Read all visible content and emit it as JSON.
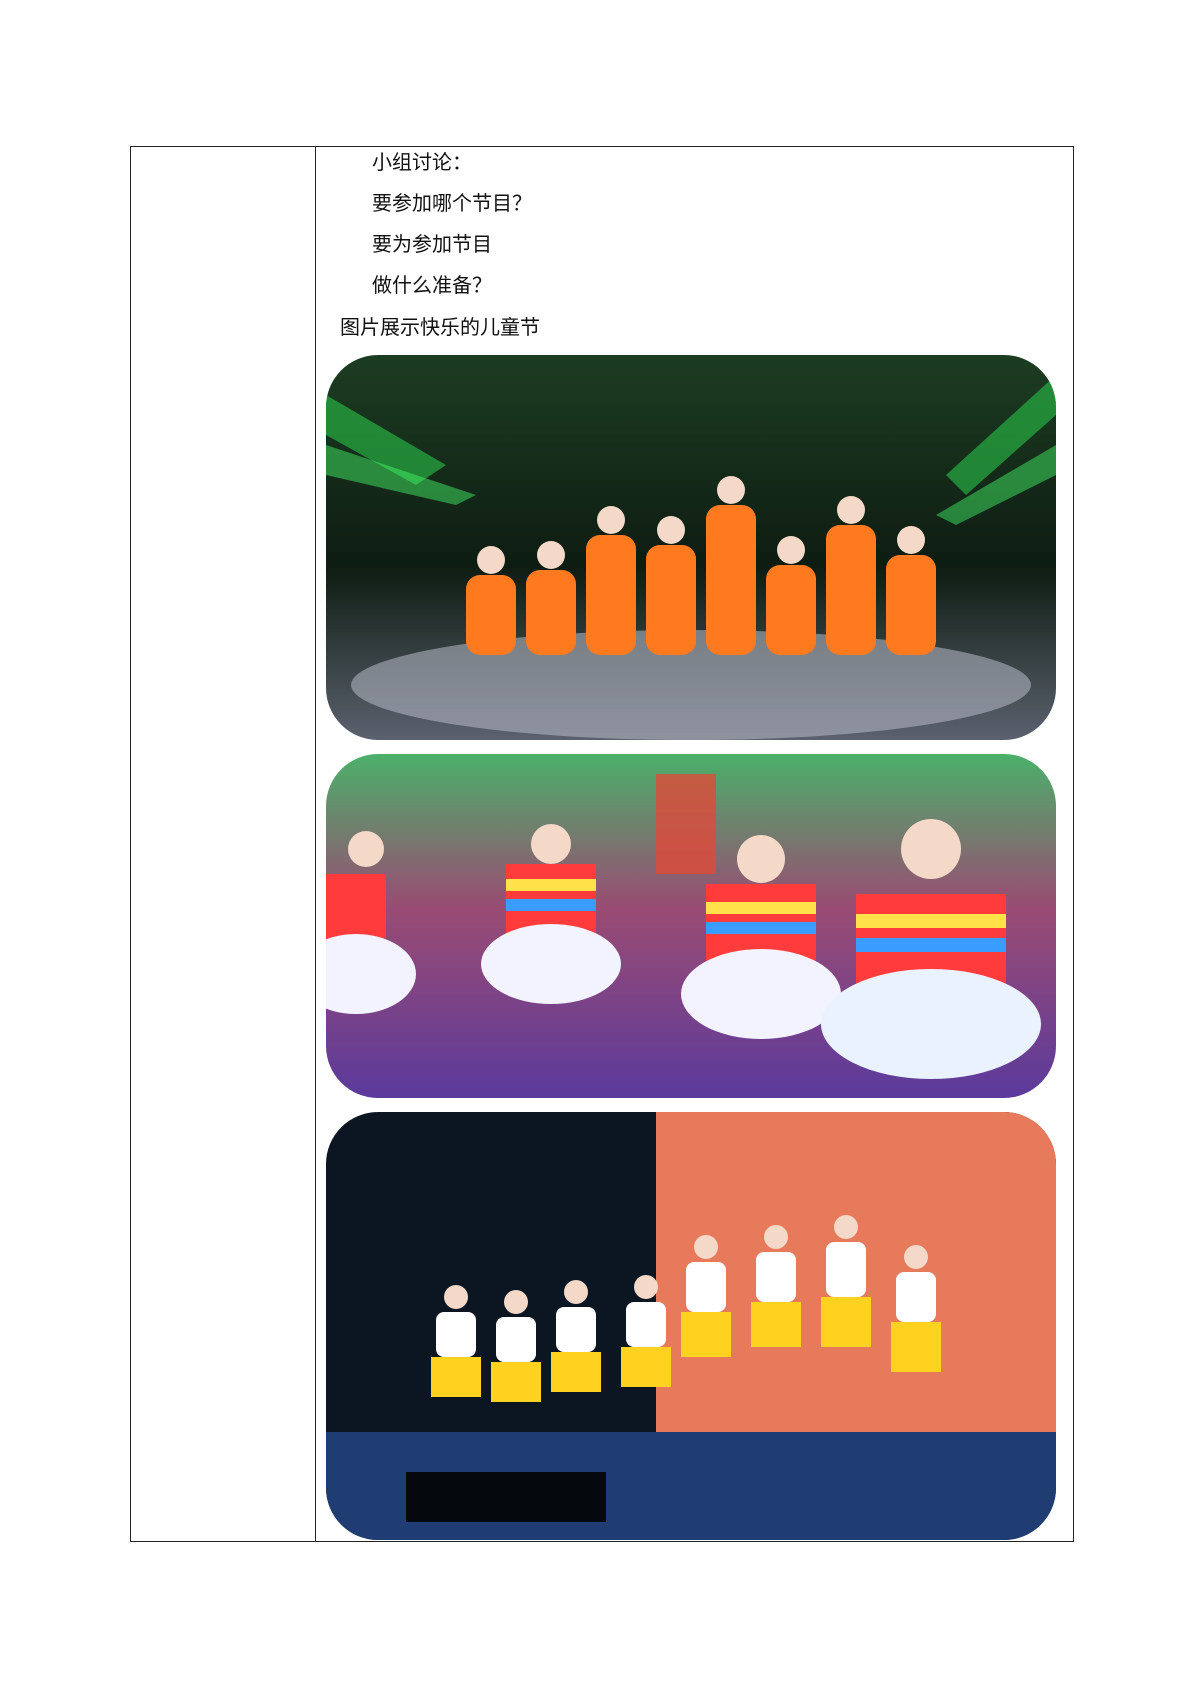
{
  "lines": {
    "l1": "小组讨论：",
    "l2": "要参加哪个节目？",
    "l3": "要为参加节目",
    "l4": "做什么准备？",
    "caption": "图片展示快乐的儿童节"
  },
  "photos": [
    {
      "name": "children-dance-photo-1",
      "palette": [
        "#0f2a18",
        "#2bd14d",
        "#ff7a1f",
        "#f4f4f4"
      ]
    },
    {
      "name": "children-dance-photo-2",
      "palette": [
        "#7a3d7c",
        "#ff3b3b",
        "#ffe14a",
        "#3a9cff"
      ]
    },
    {
      "name": "children-dance-photo-3",
      "palette": [
        "#0c1622",
        "#e77a5a",
        "#ffd21f",
        "#ffffff"
      ]
    }
  ]
}
